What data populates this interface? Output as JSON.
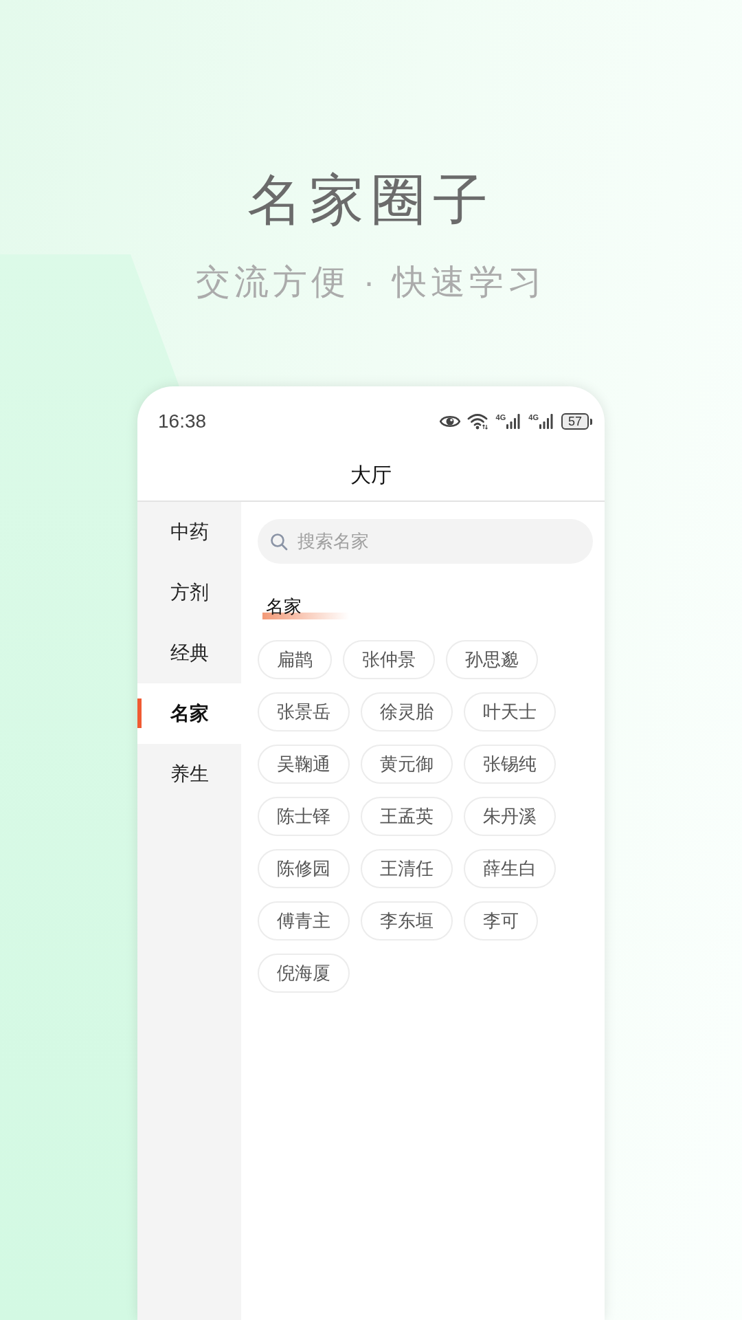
{
  "hero": {
    "title": "名家圈子",
    "subtitle": "交流方便 · 快速学习"
  },
  "status_bar": {
    "time": "16:38",
    "networks": [
      "4G",
      "4G"
    ],
    "battery": "57"
  },
  "header": {
    "title": "大厅"
  },
  "categories": [
    {
      "label": "中药",
      "selected": false
    },
    {
      "label": "方剂",
      "selected": false
    },
    {
      "label": "经典",
      "selected": false
    },
    {
      "label": "名家",
      "selected": true
    },
    {
      "label": "养生",
      "selected": false
    }
  ],
  "search": {
    "placeholder": "搜索名家"
  },
  "section": {
    "title": "名家"
  },
  "tags": [
    "扁鹊",
    "张仲景",
    "孙思邈",
    "张景岳",
    "徐灵胎",
    "叶天士",
    "吴鞠通",
    "黄元御",
    "张锡纯",
    "陈士铎",
    "王孟英",
    "朱丹溪",
    "陈修园",
    "王清任",
    "薛生白",
    "傅青主",
    "李东垣",
    "李可",
    "倪海厦"
  ]
}
